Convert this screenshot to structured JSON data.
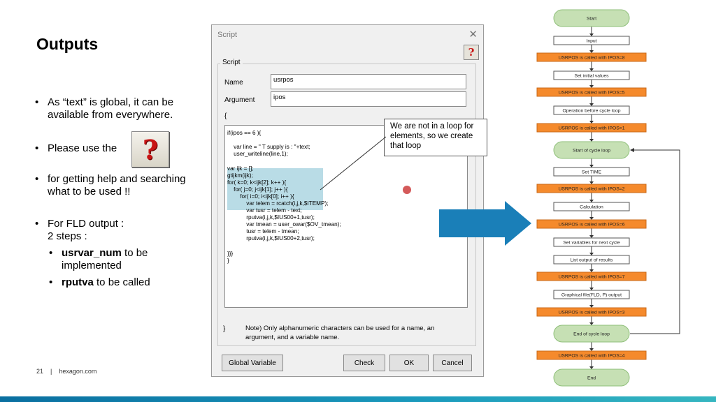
{
  "slide": {
    "title": "Outputs",
    "bullet1": "As “text” is global, it can be available from everywhere.",
    "bullet2a": "Please use the",
    "bullet2b": "for getting help and searching what to be used !!",
    "bullet3": "For FLD output :",
    "bullet3b": "2 steps :",
    "sub1_bold": "usrvar_num",
    "sub1_rest": " to be implemented",
    "sub2_bold": "rputva",
    "sub2_rest": " to be called",
    "help_glyph": "?",
    "footer_page": "21",
    "footer_sep": "|",
    "footer_site": "hexagon.com"
  },
  "dialog": {
    "title": "Script",
    "close": "✕",
    "help_glyph": "?",
    "group_label": "Script",
    "name_label": "Name",
    "name_value": "usrpos",
    "argument_label": "Argument",
    "argument_value": "ipos",
    "brace_open": "{",
    "brace_close": "}",
    "code": [
      "if(ipos == 6 ){",
      "",
      "    var line = \" T supply is : \"+text;",
      "    user_writeline(line,1);",
      "",
      "var ijk = [];",
      "gtijkm(ijk);",
      "for( k=0; k<ijk[2]; k++ ){",
      "    for( j=0; j<ijk[1]; j++ ){",
      "        for( i=0; i<ijk[0]; i++ ){",
      "            var telem = rcatch(i,j,k,$ITEMP);",
      "            var tusr = telem - text;",
      "            rputva(i,j,k,$IUS00+1,tusr);",
      "            var tmean = user_owar($OV_tmean);",
      "            tusr = telem - tmean;",
      "            rputva(i,j,k,$IUS00+2,tusr);",
      "",
      "}}}",
      "}"
    ],
    "note": "Note) Only alphanumeric characters can be used for a name, an argument, and a variable name.",
    "buttons": {
      "global_variable": "Global Variable",
      "check": "Check",
      "ok": "OK",
      "cancel": "Cancel"
    }
  },
  "callout": "We are not in a loop for elements, so we create that loop",
  "flowchart": {
    "nodes": [
      {
        "label": "Start",
        "kind": "terminal"
      },
      {
        "label": "Input",
        "kind": "process"
      },
      {
        "label": "USRPOS is called with IPOS=8",
        "kind": "call"
      },
      {
        "label": "Set initial values",
        "kind": "process"
      },
      {
        "label": "USRPOS is called with IPOS=5",
        "kind": "call"
      },
      {
        "label": "Operation before cycle loop",
        "kind": "process"
      },
      {
        "label": "USRPOS is called with IPOS=1",
        "kind": "call"
      },
      {
        "label": "Start of cycle loop",
        "kind": "terminal"
      },
      {
        "label": "Set TIME",
        "kind": "process"
      },
      {
        "label": "USRPOS is called with IPOS=2",
        "kind": "call"
      },
      {
        "label": "Calculation",
        "kind": "process"
      },
      {
        "label": "USRPOS is called with IPOS=6",
        "kind": "call"
      },
      {
        "label": "Set variables for next cycle",
        "kind": "process"
      },
      {
        "label": "List output of results",
        "kind": "process"
      },
      {
        "label": "USRPOS is called with IPOS=7",
        "kind": "call"
      },
      {
        "label": "Graphical file(FLD, P) output",
        "kind": "process"
      },
      {
        "label": "USRPOS is called with IPOS=3",
        "kind": "call"
      },
      {
        "label": "End of cycle loop",
        "kind": "terminal"
      },
      {
        "label": "USRPOS is called with IPOS=4",
        "kind": "call"
      },
      {
        "label": "End",
        "kind": "terminal"
      }
    ],
    "colors": {
      "terminal_fill": "#c6e0b4",
      "terminal_stroke": "#8fbf7a",
      "call_fill": "#f58a2c",
      "call_stroke": "#c96a1a",
      "process_fill": "#ffffff",
      "process_stroke": "#555555",
      "arrow_fill": "#1a7fb8"
    }
  }
}
